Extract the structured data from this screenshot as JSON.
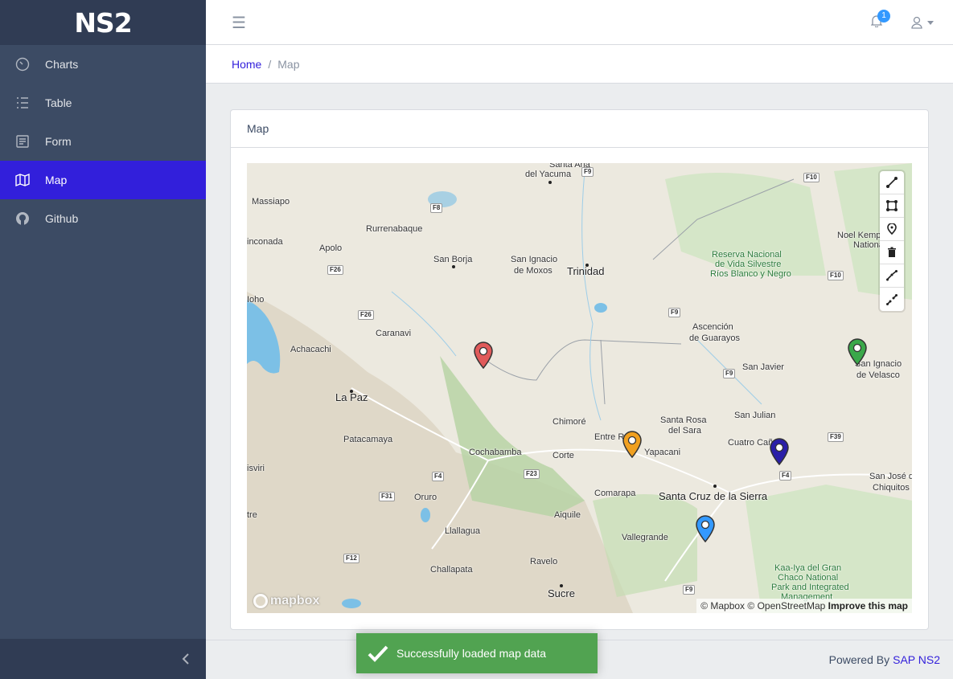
{
  "brand": {
    "logo_text": "NS2"
  },
  "sidebar": {
    "items": [
      {
        "label": "Charts",
        "icon": "speedometer-icon"
      },
      {
        "label": "Table",
        "icon": "list-icon"
      },
      {
        "label": "Form",
        "icon": "notes-icon"
      },
      {
        "label": "Map",
        "icon": "map-icon",
        "active": true
      },
      {
        "label": "Github",
        "icon": "github-icon"
      }
    ]
  },
  "header": {
    "menu_icon": "☰",
    "notification_count": "1"
  },
  "breadcrumb": {
    "home": "Home",
    "separator": "/",
    "current": "Map"
  },
  "card": {
    "title": "Map"
  },
  "map": {
    "places": [
      "Santa Ana",
      "del Yacuma",
      "Massiapo",
      "Rurrenabaque",
      "inconada",
      "Apolo",
      "San Borja",
      "San Ignacio",
      "de Moxos",
      "Trinidad",
      "Ioho",
      "Caranavi",
      "Achacachi",
      "La Paz",
      "Patacamaya",
      "Cochabamba",
      "Chimoré",
      "Entre R",
      "Corte",
      "Santa Rosa",
      "del Sara",
      "Yapacani",
      "Ascención",
      "de Guarayos",
      "San Javier",
      "San Julian",
      "Cuatro Cañ",
      "San Ignacio",
      "de Velasco",
      "San José de",
      "Chiquitos",
      "Oruro",
      "Llallagua",
      "Aiquile",
      "Comarapa",
      "Santa Cruz de la Sierra",
      "Vallegrande",
      "Challapata",
      "Ravelo",
      "Sucre",
      "isviri",
      "tre",
      "Noel Kemp",
      "Nationa"
    ],
    "parks": [
      "Reserva Nacional",
      "de Vida Silvestre",
      "Ríos Blanco y Negro",
      "Kaa-Iya del Gran",
      "Chaco National",
      "Park and Integrated",
      "Management"
    ],
    "roads": [
      "F9",
      "F10",
      "F8",
      "F26",
      "F26",
      "F10",
      "F9",
      "F9",
      "F39",
      "F4",
      "F23",
      "F4",
      "F31",
      "F12",
      "F9"
    ],
    "markers": [
      {
        "color": "#e05a5a"
      },
      {
        "color": "#f0a020"
      },
      {
        "color": "#2a1fa8"
      },
      {
        "color": "#3aa84a"
      },
      {
        "color": "#3399ff"
      }
    ],
    "draw_tools": [
      "line-icon",
      "polygon-icon",
      "point-icon",
      "trash-icon",
      "combine-icon",
      "uncombine-icon"
    ],
    "attribution": {
      "mapbox": "© Mapbox",
      "osm": "© OpenStreetMap",
      "improve": "Improve this map"
    },
    "logo": "mapbox"
  },
  "footer": {
    "powered_by": "Powered By",
    "link": "SAP NS2"
  },
  "toast": {
    "message": "Successfully loaded map data"
  },
  "colors": {
    "sidebar": "#3c4b64",
    "active": "#321fdb",
    "toast": "#51a351",
    "badge": "#3399ff"
  }
}
